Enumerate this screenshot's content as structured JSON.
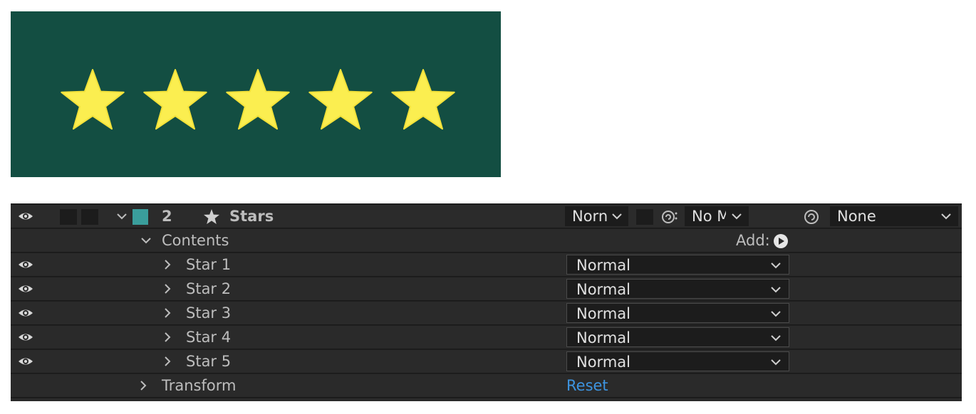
{
  "preview": {
    "background": "#134e42",
    "star_color": "#fbee50",
    "star_count": 5
  },
  "layer": {
    "number": "2",
    "name": "Stars",
    "label_color": "#3a9e9c",
    "mode": "Norn",
    "track_matte": "No M",
    "parent": "None"
  },
  "contents": {
    "label": "Contents",
    "add_label": "Add:"
  },
  "stars": [
    {
      "label": "Star 1",
      "mode": "Normal"
    },
    {
      "label": "Star 2",
      "mode": "Normal"
    },
    {
      "label": "Star 3",
      "mode": "Normal"
    },
    {
      "label": "Star 4",
      "mode": "Normal"
    },
    {
      "label": "Star 5",
      "mode": "Normal"
    }
  ],
  "transform": {
    "label": "Transform",
    "reset_label": "Reset"
  }
}
